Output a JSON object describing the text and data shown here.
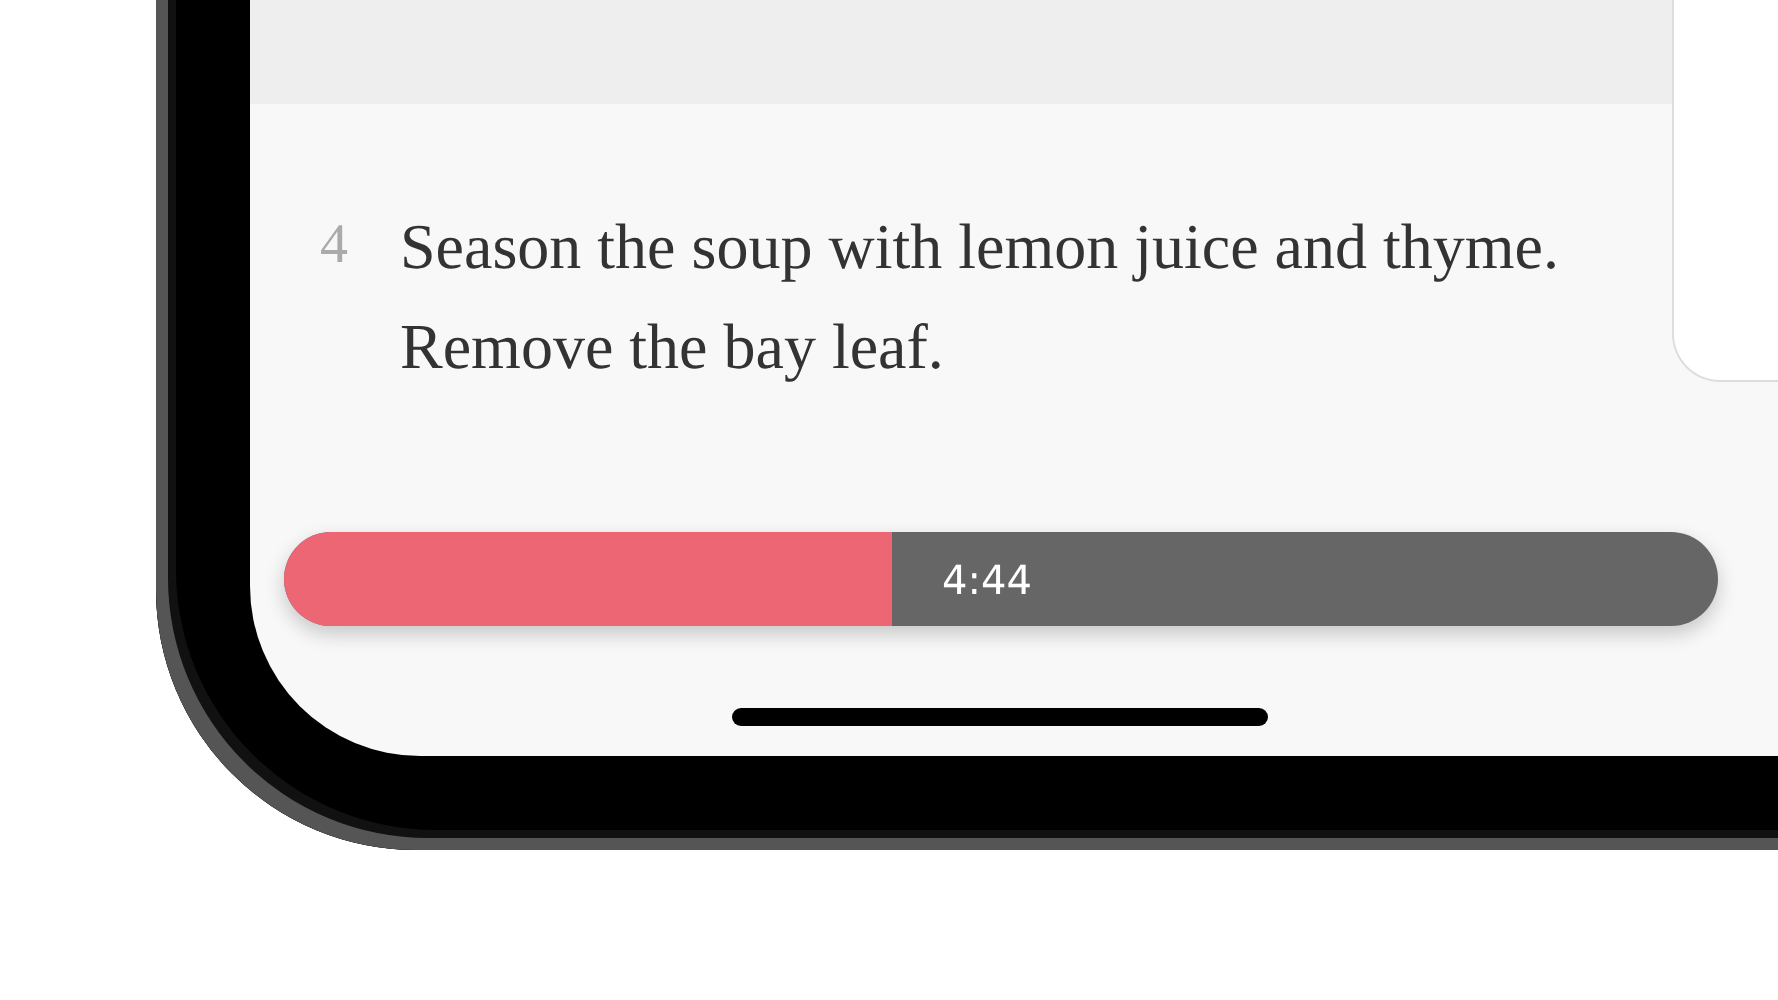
{
  "step": {
    "number": "4",
    "text": "Season the soup with lemon juice and thyme. Remove the bay leaf."
  },
  "timer": {
    "level": 0.424,
    "time": "4:44"
  }
}
